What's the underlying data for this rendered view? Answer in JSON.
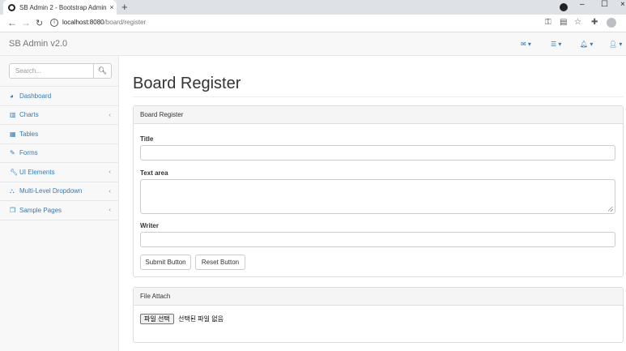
{
  "browser": {
    "tab_title": "SB Admin 2 - Bootstrap Admin",
    "tab_close": "×",
    "new_tab": "+",
    "url_host": "localhost:8080",
    "url_path": "/board/register",
    "win_min": "–",
    "win_max": "☐",
    "win_close": "×"
  },
  "navbar": {
    "brand": "SB Admin v2.0",
    "icons": [
      "envelope-icon",
      "tasks-icon",
      "bell-icon",
      "user-icon"
    ]
  },
  "sidebar": {
    "search_placeholder": "Search...",
    "items": [
      {
        "icon": "dashboard-icon",
        "label": "Dashboard",
        "has_arrow": false
      },
      {
        "icon": "bar-chart-icon",
        "label": "Charts",
        "has_arrow": true
      },
      {
        "icon": "table-icon",
        "label": "Tables",
        "has_arrow": false
      },
      {
        "icon": "edit-icon",
        "label": "Forms",
        "has_arrow": false
      },
      {
        "icon": "wrench-icon",
        "label": "UI Elements",
        "has_arrow": true
      },
      {
        "icon": "sitemap-icon",
        "label": "Multi-Level Dropdown",
        "has_arrow": true
      },
      {
        "icon": "files-icon",
        "label": "Sample Pages",
        "has_arrow": true
      }
    ]
  },
  "main": {
    "page_title": "Board Register",
    "form_panel": {
      "heading": "Board Register",
      "title_label": "Title",
      "title_value": "",
      "textarea_label": "Text area",
      "textarea_value": "",
      "writer_label": "Writer",
      "writer_value": "",
      "submit_label": "Submit Button",
      "reset_label": "Reset Button"
    },
    "file_panel": {
      "heading": "File Attach",
      "choose_button": "파일 선택",
      "no_file_text": "선택된 파일 없음"
    }
  }
}
